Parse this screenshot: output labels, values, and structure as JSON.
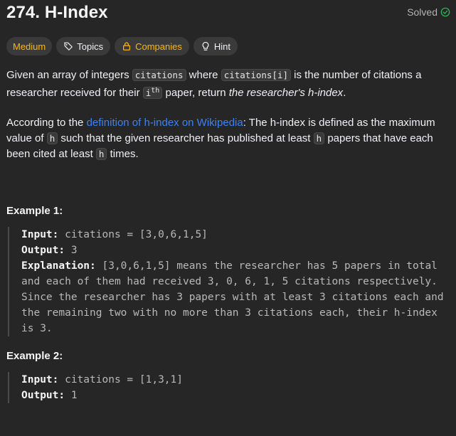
{
  "problem": {
    "title": "274. H-Index",
    "status": "Solved"
  },
  "tags": {
    "difficulty": "Medium",
    "topics": "Topics",
    "companies": "Companies",
    "hint": "Hint"
  },
  "description": {
    "p1_a": "Given an array of integers ",
    "p1_code1": "citations",
    "p1_b": " where ",
    "p1_code2": "citations[i]",
    "p1_c": " is the number of citations a researcher received for their ",
    "p1_code3": "i",
    "p1_code3_sup": "th",
    "p1_d": " paper, return ",
    "p1_em": "the researcher's h-index",
    "p1_e": ".",
    "p2_a": "According to the ",
    "p2_link": "definition of h-index on Wikipedia",
    "p2_b": ": The h-index is defined as the maximum value of ",
    "p2_code1": "h",
    "p2_c": " such that the given researcher has published at least ",
    "p2_code2": "h",
    "p2_d": " papers that have each been cited at least ",
    "p2_code3": "h",
    "p2_e": " times."
  },
  "examples": [
    {
      "title": "Example 1:",
      "input_label": "Input:",
      "input_value": " citations = [3,0,6,1,5]",
      "output_label": "Output:",
      "output_value": " 3",
      "explanation_label": "Explanation:",
      "explanation_value": " [3,0,6,1,5] means the researcher has 5 papers in total and each of them had received 3, 0, 6, 1, 5 citations respectively.\nSince the researcher has 3 papers with at least 3 citations each and the remaining two with no more than 3 citations each, their h-index is 3."
    },
    {
      "title": "Example 2:",
      "input_label": "Input:",
      "input_value": " citations = [1,3,1]",
      "output_label": "Output:",
      "output_value": " 1"
    }
  ],
  "colors": {
    "background": "#262626",
    "difficulty_medium": "#ffb800",
    "link": "#3b82f6",
    "solved_check": "#2cbb5d"
  },
  "icons": {
    "solved": "check-circle-icon",
    "topics": "tag-icon",
    "companies": "lock-icon",
    "hint": "lightbulb-icon"
  }
}
